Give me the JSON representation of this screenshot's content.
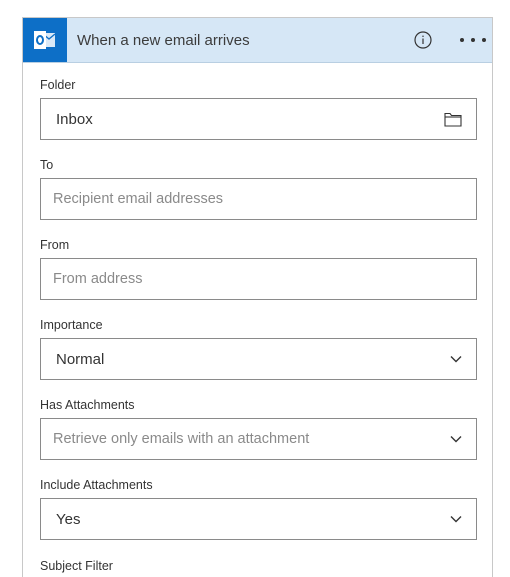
{
  "header": {
    "title": "When a new email arrives",
    "app_icon": "outlook-icon",
    "info_icon": "info-icon",
    "more_icon": "more-options-icon",
    "color": "#d6e7f6",
    "app_icon_color": "#0d6fc7"
  },
  "fields": {
    "folder": {
      "label": "Folder",
      "value": "Inbox",
      "icon": "folder-icon"
    },
    "to": {
      "label": "To",
      "placeholder": "Recipient email addresses"
    },
    "from": {
      "label": "From",
      "placeholder": "From address"
    },
    "importance": {
      "label": "Importance",
      "value": "Normal",
      "icon": "chevron-down-icon"
    },
    "has_attachments": {
      "label": "Has Attachments",
      "placeholder": "Retrieve only emails with an attachment",
      "icon": "chevron-down-icon"
    },
    "include_attachments": {
      "label": "Include Attachments",
      "value": "Yes",
      "icon": "chevron-down-icon"
    },
    "subject_filter": {
      "label": "Subject Filter"
    }
  }
}
